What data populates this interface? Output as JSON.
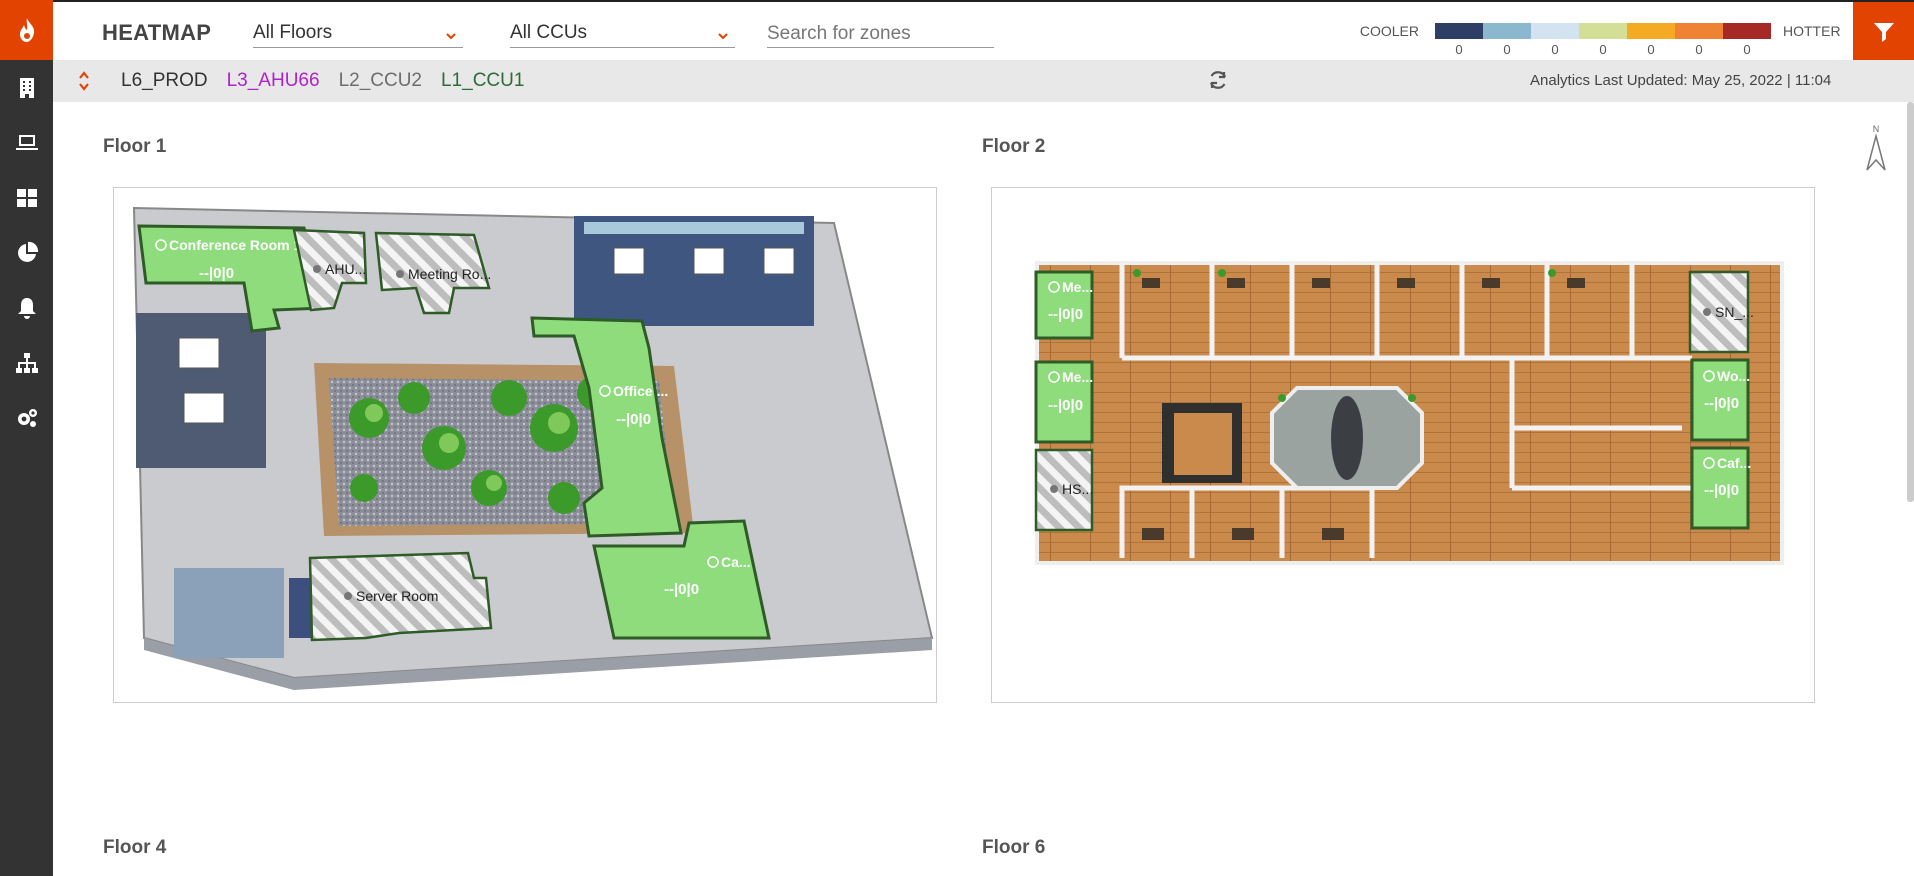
{
  "header": {
    "title": "HEATMAP",
    "floor_select": "All Floors",
    "ccu_select": "All CCUs",
    "search_placeholder": "Search for zones"
  },
  "legend": {
    "cooler": "COOLER",
    "hotter": "HOTTER",
    "colors": [
      "#2e3f66",
      "#8bb7cf",
      "#d3e3ef",
      "#d3df97",
      "#f4aa23",
      "#ef8233",
      "#a72926"
    ],
    "counts": [
      "0",
      "0",
      "0",
      "0",
      "0",
      "0",
      "0"
    ]
  },
  "subbar": {
    "crumbs": [
      {
        "label": "L6_PROD",
        "color": "#333333"
      },
      {
        "label": "L3_AHU66",
        "color": "#b022c9"
      },
      {
        "label": "L2_CCU2",
        "color": "#6d6d6d"
      },
      {
        "label": "L1_CCU1",
        "color": "#2f6b3a"
      }
    ],
    "updated": "Analytics Last Updated: May 25, 2022 | 11:04"
  },
  "compass_label": "N",
  "floors": [
    {
      "title": "Floor 1"
    },
    {
      "title": "Floor 2"
    },
    {
      "title": "Floor 4"
    },
    {
      "title": "Floor 6"
    }
  ],
  "floor1_zones": {
    "conference": {
      "label": "Conference Room 1",
      "value": "--|0|0"
    },
    "ahu": {
      "label": "AHU..."
    },
    "meeting": {
      "label": "Meeting Ro..."
    },
    "office": {
      "label": "Office ...",
      "value": "--|0|0"
    },
    "ca": {
      "label": "Ca...",
      "value": "--|0|0"
    },
    "server": {
      "label": "Server Room"
    }
  },
  "floor2_zones": {
    "me1": {
      "label": "Me...",
      "value": "--|0|0"
    },
    "me2": {
      "label": "Me...",
      "value": "--|0|0"
    },
    "hs": {
      "label": "HS..."
    },
    "sn": {
      "label": "SN_..."
    },
    "wo": {
      "label": "Wo...",
      "value": "--|0|0"
    },
    "caf": {
      "label": "Caf...",
      "value": "--|0|0"
    }
  },
  "colors": {
    "accent": "#e24301",
    "sidebar": "#333333",
    "zone_green": "#8fdc7d",
    "zone_border": "#2e5b26"
  }
}
